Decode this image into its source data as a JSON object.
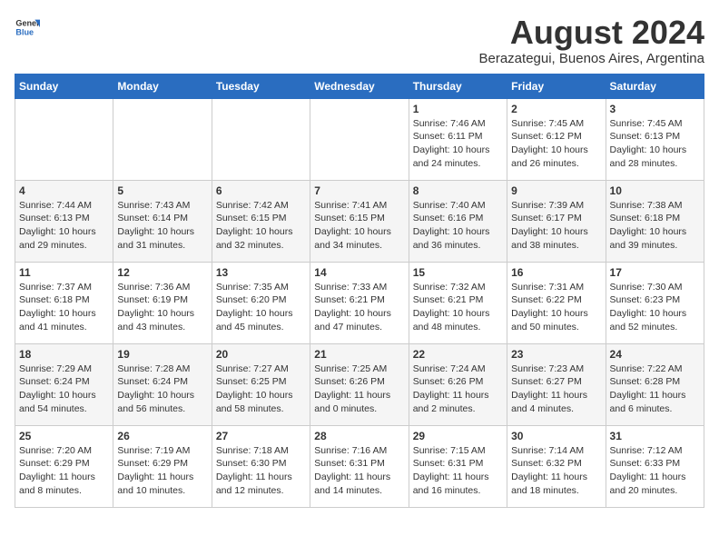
{
  "header": {
    "logo_general": "General",
    "logo_blue": "Blue",
    "main_title": "August 2024",
    "subtitle": "Berazategui, Buenos Aires, Argentina"
  },
  "calendar": {
    "days_of_week": [
      "Sunday",
      "Monday",
      "Tuesday",
      "Wednesday",
      "Thursday",
      "Friday",
      "Saturday"
    ],
    "weeks": [
      [
        {
          "day": "",
          "info": ""
        },
        {
          "day": "",
          "info": ""
        },
        {
          "day": "",
          "info": ""
        },
        {
          "day": "",
          "info": ""
        },
        {
          "day": "1",
          "info": "Sunrise: 7:46 AM\nSunset: 6:11 PM\nDaylight: 10 hours and 24 minutes."
        },
        {
          "day": "2",
          "info": "Sunrise: 7:45 AM\nSunset: 6:12 PM\nDaylight: 10 hours and 26 minutes."
        },
        {
          "day": "3",
          "info": "Sunrise: 7:45 AM\nSunset: 6:13 PM\nDaylight: 10 hours and 28 minutes."
        }
      ],
      [
        {
          "day": "4",
          "info": "Sunrise: 7:44 AM\nSunset: 6:13 PM\nDaylight: 10 hours and 29 minutes."
        },
        {
          "day": "5",
          "info": "Sunrise: 7:43 AM\nSunset: 6:14 PM\nDaylight: 10 hours and 31 minutes."
        },
        {
          "day": "6",
          "info": "Sunrise: 7:42 AM\nSunset: 6:15 PM\nDaylight: 10 hours and 32 minutes."
        },
        {
          "day": "7",
          "info": "Sunrise: 7:41 AM\nSunset: 6:15 PM\nDaylight: 10 hours and 34 minutes."
        },
        {
          "day": "8",
          "info": "Sunrise: 7:40 AM\nSunset: 6:16 PM\nDaylight: 10 hours and 36 minutes."
        },
        {
          "day": "9",
          "info": "Sunrise: 7:39 AM\nSunset: 6:17 PM\nDaylight: 10 hours and 38 minutes."
        },
        {
          "day": "10",
          "info": "Sunrise: 7:38 AM\nSunset: 6:18 PM\nDaylight: 10 hours and 39 minutes."
        }
      ],
      [
        {
          "day": "11",
          "info": "Sunrise: 7:37 AM\nSunset: 6:18 PM\nDaylight: 10 hours and 41 minutes."
        },
        {
          "day": "12",
          "info": "Sunrise: 7:36 AM\nSunset: 6:19 PM\nDaylight: 10 hours and 43 minutes."
        },
        {
          "day": "13",
          "info": "Sunrise: 7:35 AM\nSunset: 6:20 PM\nDaylight: 10 hours and 45 minutes."
        },
        {
          "day": "14",
          "info": "Sunrise: 7:33 AM\nSunset: 6:21 PM\nDaylight: 10 hours and 47 minutes."
        },
        {
          "day": "15",
          "info": "Sunrise: 7:32 AM\nSunset: 6:21 PM\nDaylight: 10 hours and 48 minutes."
        },
        {
          "day": "16",
          "info": "Sunrise: 7:31 AM\nSunset: 6:22 PM\nDaylight: 10 hours and 50 minutes."
        },
        {
          "day": "17",
          "info": "Sunrise: 7:30 AM\nSunset: 6:23 PM\nDaylight: 10 hours and 52 minutes."
        }
      ],
      [
        {
          "day": "18",
          "info": "Sunrise: 7:29 AM\nSunset: 6:24 PM\nDaylight: 10 hours and 54 minutes."
        },
        {
          "day": "19",
          "info": "Sunrise: 7:28 AM\nSunset: 6:24 PM\nDaylight: 10 hours and 56 minutes."
        },
        {
          "day": "20",
          "info": "Sunrise: 7:27 AM\nSunset: 6:25 PM\nDaylight: 10 hours and 58 minutes."
        },
        {
          "day": "21",
          "info": "Sunrise: 7:25 AM\nSunset: 6:26 PM\nDaylight: 11 hours and 0 minutes."
        },
        {
          "day": "22",
          "info": "Sunrise: 7:24 AM\nSunset: 6:26 PM\nDaylight: 11 hours and 2 minutes."
        },
        {
          "day": "23",
          "info": "Sunrise: 7:23 AM\nSunset: 6:27 PM\nDaylight: 11 hours and 4 minutes."
        },
        {
          "day": "24",
          "info": "Sunrise: 7:22 AM\nSunset: 6:28 PM\nDaylight: 11 hours and 6 minutes."
        }
      ],
      [
        {
          "day": "25",
          "info": "Sunrise: 7:20 AM\nSunset: 6:29 PM\nDaylight: 11 hours and 8 minutes."
        },
        {
          "day": "26",
          "info": "Sunrise: 7:19 AM\nSunset: 6:29 PM\nDaylight: 11 hours and 10 minutes."
        },
        {
          "day": "27",
          "info": "Sunrise: 7:18 AM\nSunset: 6:30 PM\nDaylight: 11 hours and 12 minutes."
        },
        {
          "day": "28",
          "info": "Sunrise: 7:16 AM\nSunset: 6:31 PM\nDaylight: 11 hours and 14 minutes."
        },
        {
          "day": "29",
          "info": "Sunrise: 7:15 AM\nSunset: 6:31 PM\nDaylight: 11 hours and 16 minutes."
        },
        {
          "day": "30",
          "info": "Sunrise: 7:14 AM\nSunset: 6:32 PM\nDaylight: 11 hours and 18 minutes."
        },
        {
          "day": "31",
          "info": "Sunrise: 7:12 AM\nSunset: 6:33 PM\nDaylight: 11 hours and 20 minutes."
        }
      ]
    ]
  }
}
